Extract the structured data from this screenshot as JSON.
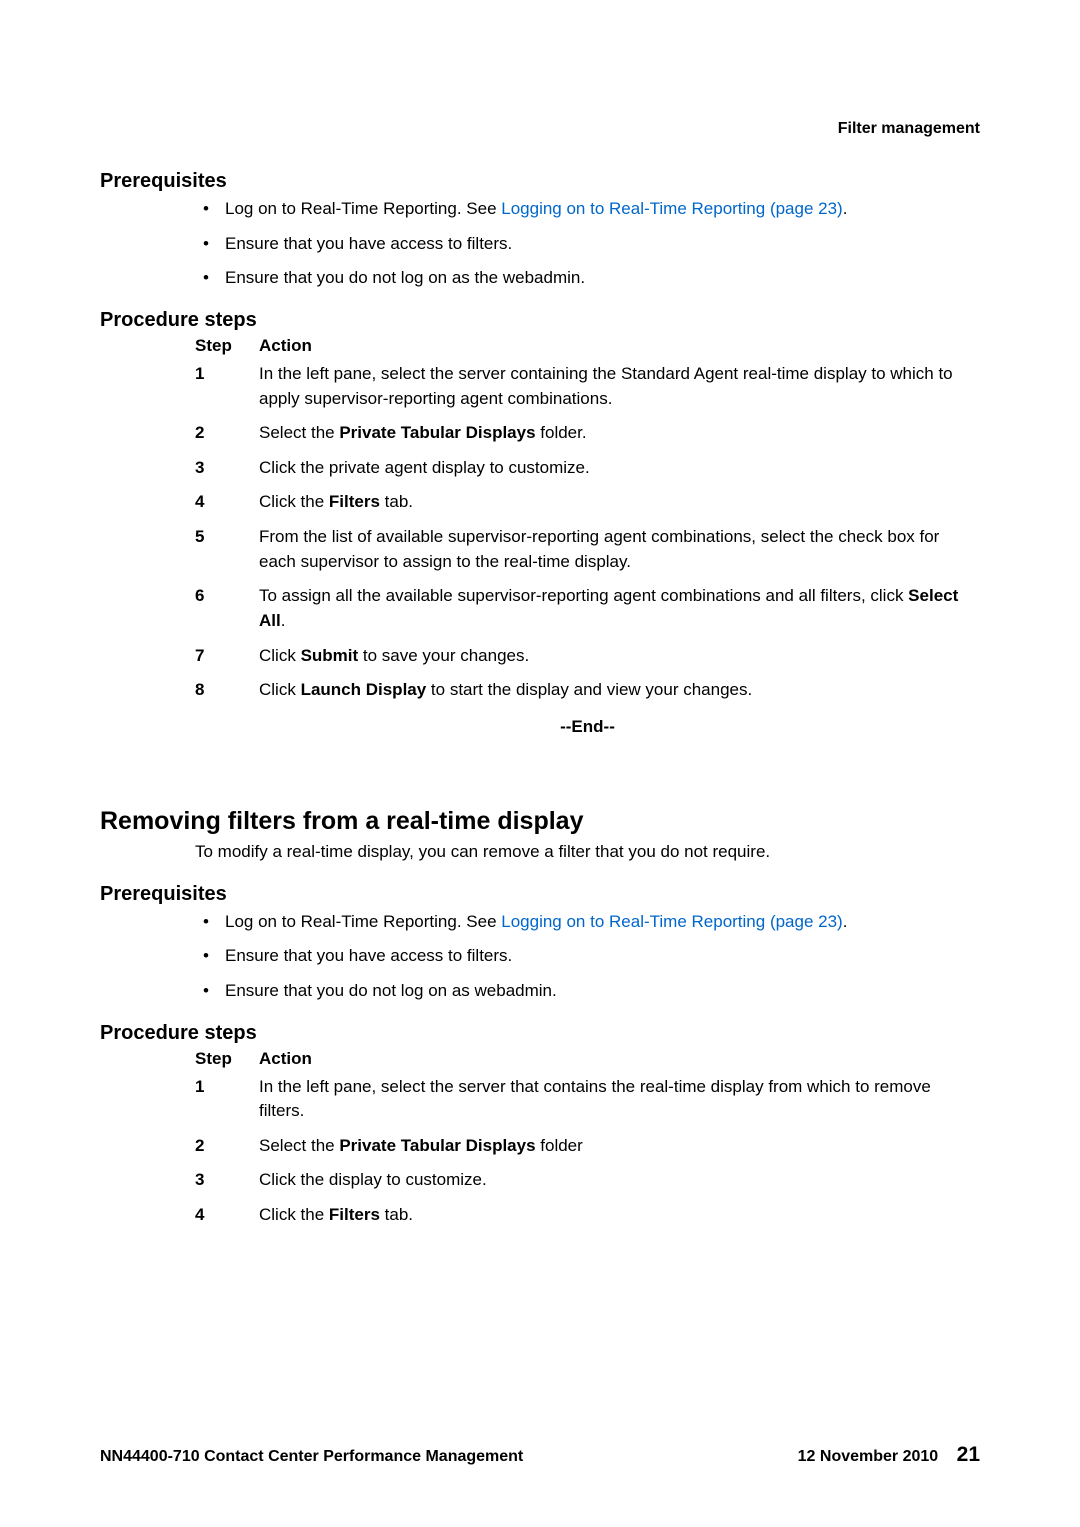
{
  "header": {
    "section": "Filter management"
  },
  "sec1": {
    "prereq_heading": "Prerequisites",
    "prereq_items": [
      {
        "pre": "Log on to Real-Time Reporting. See ",
        "link": "Logging on to Real-Time Reporting (page 23)",
        "post": "."
      },
      {
        "pre": "Ensure that you have access to filters."
      },
      {
        "pre": "Ensure that you do not log on as the webadmin."
      }
    ],
    "steps_heading": "Procedure steps",
    "col_step": "Step",
    "col_action": "Action",
    "steps": [
      {
        "n": "1",
        "html": "In the left pane, select the server containing the Standard Agent real-time display to which to apply supervisor-reporting agent combinations."
      },
      {
        "n": "2",
        "html": "Select the <b>Private Tabular Displays</b> folder."
      },
      {
        "n": "3",
        "html": "Click the private agent display to customize."
      },
      {
        "n": "4",
        "html": "Click the <b>Filters</b> tab."
      },
      {
        "n": "5",
        "html": "From the list of available supervisor-reporting agent combinations, select the check box for each supervisor to assign to the real-time display."
      },
      {
        "n": "6",
        "html": "To assign all the available supervisor-reporting agent combinations and all filters, click <b>Select All</b>."
      },
      {
        "n": "7",
        "html": "Click <b>Submit</b> to save your changes."
      },
      {
        "n": "8",
        "html": "Click <b>Launch Display</b> to start the display and view your changes."
      }
    ],
    "end": "--End--"
  },
  "sec2": {
    "title": "Removing filters from a real-time display",
    "intro": "To modify a real-time display, you can remove a filter that you do not require.",
    "prereq_heading": "Prerequisites",
    "prereq_items": [
      {
        "pre": "Log on to Real-Time Reporting. See ",
        "link": "Logging on to Real-Time Reporting (page 23)",
        "post": "."
      },
      {
        "pre": "Ensure that you have access to filters."
      },
      {
        "pre": "Ensure that you do not log on as webadmin."
      }
    ],
    "steps_heading": "Procedure steps",
    "col_step": "Step",
    "col_action": "Action",
    "steps": [
      {
        "n": "1",
        "html": "In the left pane, select the server that contains the real-time display from which to remove filters."
      },
      {
        "n": "2",
        "html": "Select the <b>Private Tabular Displays</b> folder"
      },
      {
        "n": "3",
        "html": "Click the display to customize."
      },
      {
        "n": "4",
        "html": "Click the <b>Filters</b> tab."
      }
    ]
  },
  "footer": {
    "left": "NN44400-710 Contact Center Performance Management",
    "date": "12 November 2010",
    "page": "21"
  }
}
